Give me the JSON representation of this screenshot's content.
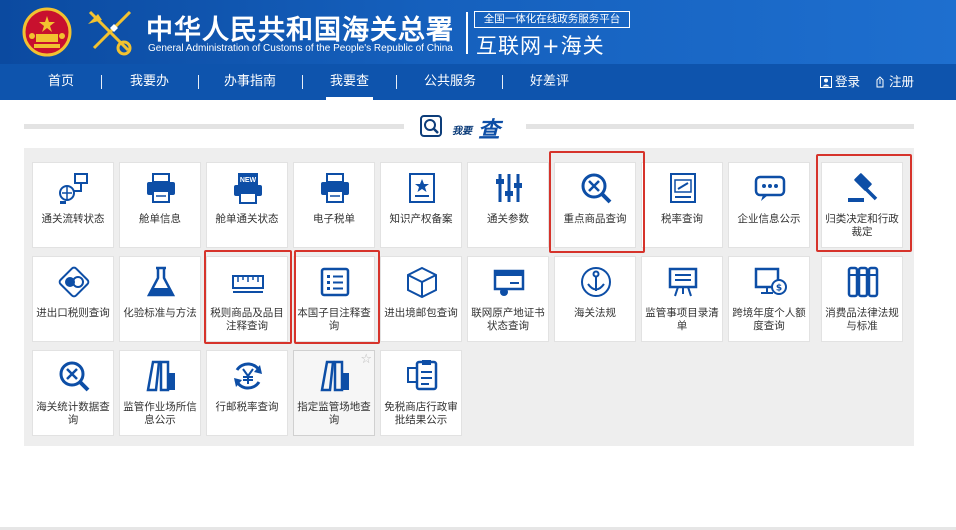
{
  "header": {
    "title_cn": "中华人民共和国海关总署",
    "title_en": "General Administration of Customs of the People's Republic of China",
    "portal_tagline": "全国一体化在线政务服务平台",
    "portal_name": "互联网+海关"
  },
  "nav": {
    "items": [
      "首页",
      "我要办",
      "办事指南",
      "我要查",
      "公共服务",
      "好差评"
    ],
    "active": "我要查",
    "login": "登录",
    "register": "注册"
  },
  "section": {
    "small": "我要",
    "big": "查"
  },
  "tiles": [
    {
      "label": "通关流转状态",
      "icon": "network-flow-icon"
    },
    {
      "label": "舱单信息",
      "icon": "printer-icon"
    },
    {
      "label": "舱单通关状态",
      "icon": "new-document-printer-icon"
    },
    {
      "label": "电子税单",
      "icon": "printer-icon"
    },
    {
      "label": "知识产权备案",
      "icon": "certificate-star-icon"
    },
    {
      "label": "通关参数",
      "icon": "sliders-icon"
    },
    {
      "label": "重点商品查询",
      "icon": "search-tools-icon"
    },
    {
      "label": "税率查询",
      "icon": "tax-book-icon"
    },
    {
      "label": "企业信息公示",
      "icon": "chat-bubble-icon"
    },
    {
      "label": "归类决定和行政裁定",
      "icon": "gavel-icon"
    },
    {
      "label": "进出口税则查询",
      "icon": "coins-icon"
    },
    {
      "label": "化验标准与方法",
      "icon": "flask-icon"
    },
    {
      "label": "税则商品及品目注释查询",
      "icon": "ruler-icon"
    },
    {
      "label": "本国子目注释查询",
      "icon": "list-document-icon"
    },
    {
      "label": "进出境邮包查询",
      "icon": "parcel-box-icon"
    },
    {
      "label": "联网原产地证书状态查询",
      "icon": "certificate-stamp-icon"
    },
    {
      "label": "海关法规",
      "icon": "anchor-icon"
    },
    {
      "label": "监管事项目录清单",
      "icon": "easel-board-icon"
    },
    {
      "label": "跨境年度个人额度查询",
      "icon": "money-monitor-icon"
    },
    {
      "label": "消费品法律法规与标准",
      "icon": "book-rack-icon"
    },
    {
      "label": "海关统计数据查询",
      "icon": "search-tools-icon"
    },
    {
      "label": "监管作业场所信息公示",
      "icon": "warehouse-icon"
    },
    {
      "label": "行邮税率查询",
      "icon": "yen-cycle-icon"
    },
    {
      "label": "指定监管场地查询",
      "icon": "warehouse-icon"
    },
    {
      "label": "免税商店行政审批结果公示",
      "icon": "clipboard-screen-icon"
    }
  ],
  "highlighted_tiles": [
    "重点商品查询",
    "归类决定和行政裁定",
    "税则商品及品目注释查询",
    "本国子目注释查询"
  ],
  "colors": {
    "header_blue": "#1560bd",
    "nav_blue": "#0e54ad",
    "icon_blue": "#0d4ea6",
    "highlight_red": "#d6332b"
  }
}
